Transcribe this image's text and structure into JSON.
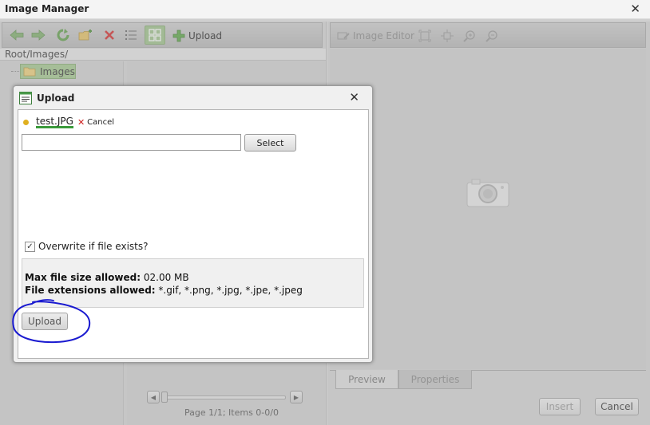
{
  "window": {
    "title": "Image Manager",
    "close_glyph": "✕"
  },
  "left_toolbar": {
    "icons": [
      "back-arrow-icon",
      "forward-arrow-icon",
      "refresh-icon",
      "new-folder-icon",
      "delete-icon",
      "list-view-icon",
      "thumbnail-view-icon"
    ],
    "upload_label": "Upload"
  },
  "path": "Root/Images/",
  "tree": {
    "root_label": "Images"
  },
  "pager": {
    "text": "Page 1/1; Items 0-0/0",
    "prev_glyph": "◀",
    "next_glyph": "▶"
  },
  "right_toolbar": {
    "image_editor_label": "Image Editor",
    "icons": [
      "image-editor-icon",
      "best-fit-icon",
      "actual-size-icon",
      "zoom-in-icon",
      "zoom-out-icon"
    ]
  },
  "tabs": {
    "preview": "Preview",
    "properties": "Properties"
  },
  "buttons": {
    "insert": "Insert",
    "cancel": "Cancel"
  },
  "upload_dialog": {
    "title": "Upload",
    "close_glyph": "✕",
    "file": {
      "name": "test.JPG",
      "remove_glyph": "✕",
      "cancel_label": "Cancel"
    },
    "file_input_value": "",
    "select_label": "Select",
    "overwrite": {
      "label": "Overwrite if file exists?",
      "checked": true,
      "check_glyph": "✓"
    },
    "max_size_label": "Max file size allowed:",
    "max_size_value": "02.00 MB",
    "extensions_label": "File extensions allowed:",
    "extensions_value": "*.gif, *.png, *.jpg, *.jpe, *.jpeg",
    "upload_label": "Upload"
  },
  "colors": {
    "active_green": "#a5c98f",
    "annotation_blue": "#1a1ad0",
    "remove_red": "#d02020"
  }
}
